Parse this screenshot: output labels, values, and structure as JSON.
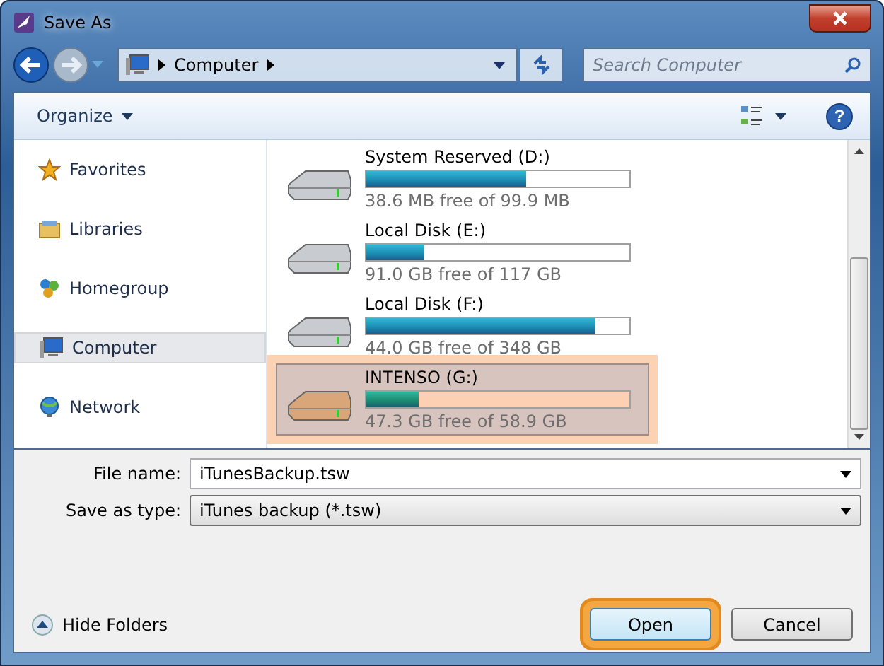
{
  "window": {
    "title": "Save As"
  },
  "address": {
    "path": "Computer"
  },
  "search": {
    "placeholder": "Search Computer"
  },
  "toolbar": {
    "organize": "Organize",
    "help": "?"
  },
  "sidebar": {
    "items": [
      {
        "label": "Favorites",
        "kind": "star",
        "selected": false
      },
      {
        "label": "Libraries",
        "kind": "library",
        "selected": false
      },
      {
        "label": "Homegroup",
        "kind": "homegroup",
        "selected": false
      },
      {
        "label": "Computer",
        "kind": "computer",
        "selected": true
      },
      {
        "label": "Network",
        "kind": "network",
        "selected": false
      }
    ]
  },
  "drives": [
    {
      "name": "System Reserved (D:)",
      "level": 0.61,
      "info": "38.6 MB free of 99.9 MB",
      "selected": false
    },
    {
      "name": "Local Disk (E:)",
      "level": 0.22,
      "info": "91.0 GB free of 117 GB",
      "selected": false
    },
    {
      "name": "Local Disk (F:)",
      "level": 0.87,
      "info": "44.0 GB free of 348 GB",
      "selected": false
    },
    {
      "name": "INTENSO (G:)",
      "level": 0.2,
      "info": "47.3 GB free of 58.9 GB",
      "selected": true
    }
  ],
  "file_name": {
    "label": "File name:",
    "value": "iTunesBackup.tsw"
  },
  "save_as_type": {
    "label": "Save as type:",
    "value": "iTunes backup (*.tsw)"
  },
  "hide_folders": "Hide Folders",
  "buttons": [
    {
      "label": "Open",
      "highlighted": true
    },
    {
      "label": "Cancel",
      "highlighted": false
    }
  ]
}
